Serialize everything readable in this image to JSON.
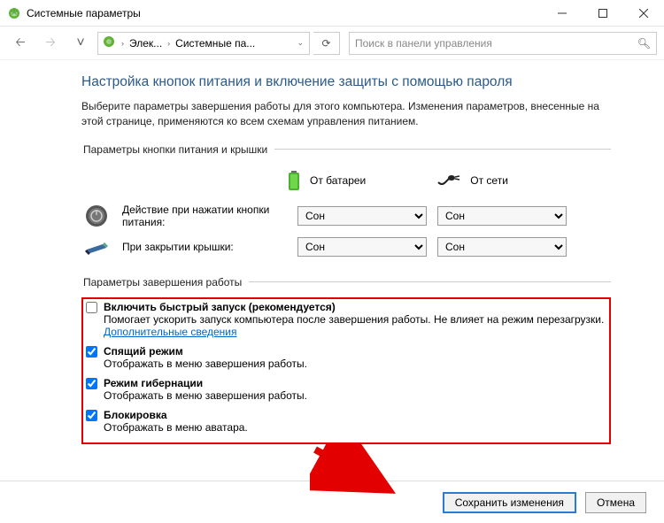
{
  "window": {
    "title": "Системные параметры"
  },
  "nav": {
    "crumb1": "Элек...",
    "crumb2": "Системные па...",
    "search_placeholder": "Поиск в панели управления"
  },
  "heading": "Настройка кнопок питания и включение защиты с помощью пароля",
  "subtext": "Выберите параметры завершения работы для этого компьютера. Изменения параметров, внесенные на этой странице, применяются ко всем схемам управления питанием.",
  "group1": {
    "legend": "Параметры кнопки питания и крышки",
    "col_battery": "От батареи",
    "col_ac": "От сети",
    "row_power_label": "Действие при нажатии кнопки питания:",
    "row_lid_label": "При закрытии крышки:",
    "sel_value": "Сон"
  },
  "group2": {
    "legend": "Параметры завершения работы",
    "opts": [
      {
        "title": "Включить быстрый запуск (рекомендуется)",
        "desc_before": "Помогает ускорить запуск компьютера после завершения работы. Не влияет на режим перезагрузки. ",
        "link": "Дополнительные сведения",
        "checked": false
      },
      {
        "title": "Спящий режим",
        "desc": "Отображать в меню завершения работы.",
        "checked": true
      },
      {
        "title": "Режим гибернации",
        "desc": "Отображать в меню завершения работы.",
        "checked": true
      },
      {
        "title": "Блокировка",
        "desc": "Отображать в меню аватара.",
        "checked": true
      }
    ]
  },
  "footer": {
    "save": "Сохранить изменения",
    "cancel": "Отмена"
  }
}
